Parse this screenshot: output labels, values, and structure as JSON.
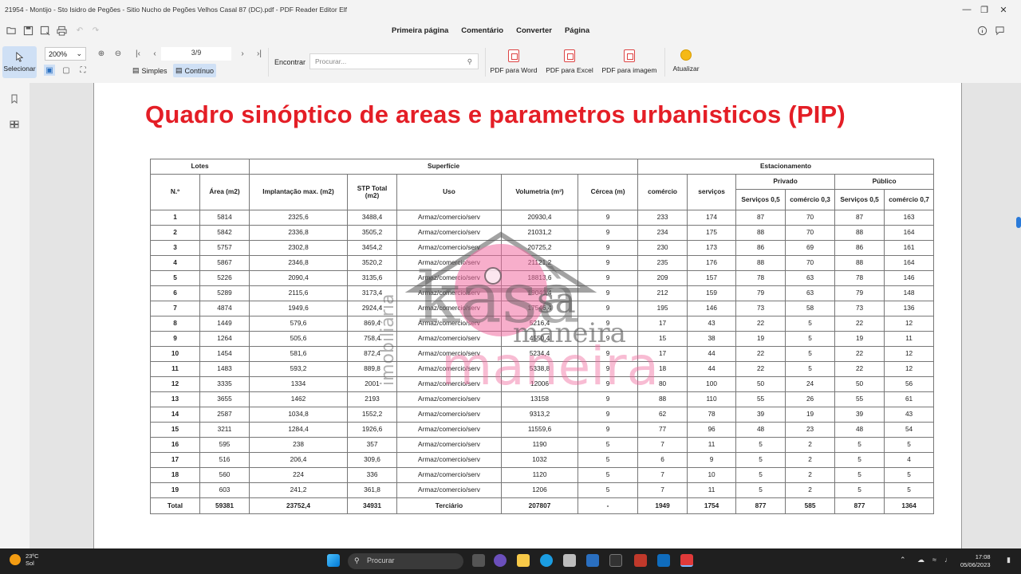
{
  "window": {
    "title": "21954 - Montijo - Sto Isidro de Pegões - Sitio Nucho de Pegões Velhos Casal 87 (DC).pdf - PDF Reader Editor Elf"
  },
  "menu": [
    "Primeira página",
    "Comentário",
    "Converter",
    "Página"
  ],
  "toolbar": {
    "select_label": "Selecionar",
    "zoom_value": "200%",
    "page_value": "3/9",
    "view_single": "Simples",
    "view_continuous": "Contínuo",
    "find_label": "Encontrar",
    "find_placeholder": "Procurar...",
    "pdf_to_word": "PDF para Word",
    "pdf_to_excel": "PDF para Excel",
    "pdf_to_image": "PDF para imagem",
    "update": "Atualizar"
  },
  "document": {
    "title": "Quadro sinóptico de areas e parametros urbanisticos (PIP)",
    "headers": {
      "lotes": "Lotes",
      "superficie": "Superfície",
      "estacionamento": "Estacionamento",
      "n": "N.º",
      "area": "Área (m2)",
      "implantacao": "Implantação max. (m2)",
      "stp_total": "STP Total (m2)",
      "uso": "Uso",
      "volumetria": "Volumetria (m³)",
      "cercea": "Cércea (m)",
      "comercio": "comércio",
      "servicos": "serviços",
      "privado": "Privado",
      "publico": "Público",
      "priv_servicos": "Serviços 0,5",
      "priv_comercio": "comércio 0,3",
      "pub_servicos": "Serviços 0,5",
      "pub_comercio": "comércio 0,7"
    },
    "rows": [
      [
        "1",
        "5814",
        "2325,6",
        "3488,4",
        "Armaz/comercio/serv",
        "20930,4",
        "9",
        "233",
        "174",
        "87",
        "70",
        "87",
        "163"
      ],
      [
        "2",
        "5842",
        "2336,8",
        "3505,2",
        "Armaz/comercio/serv",
        "21031,2",
        "9",
        "234",
        "175",
        "88",
        "70",
        "88",
        "164"
      ],
      [
        "3",
        "5757",
        "2302,8",
        "3454,2",
        "Armaz/comercio/serv",
        "20725,2",
        "9",
        "230",
        "173",
        "86",
        "69",
        "86",
        "161"
      ],
      [
        "4",
        "5867",
        "2346,8",
        "3520,2",
        "Armaz/comercio/serv",
        "21121,2",
        "9",
        "235",
        "176",
        "88",
        "70",
        "88",
        "164"
      ],
      [
        "5",
        "5226",
        "2090,4",
        "3135,6",
        "Armaz/comercio/serv",
        "18813,6",
        "9",
        "209",
        "157",
        "78",
        "63",
        "78",
        "146"
      ],
      [
        "6",
        "5289",
        "2115,6",
        "3173,4",
        "Armaz/comercio/serv",
        "19040,4",
        "9",
        "212",
        "159",
        "79",
        "63",
        "79",
        "148"
      ],
      [
        "7",
        "4874",
        "1949,6",
        "2924,4",
        "Armaz/comercio/serv",
        "17546,4",
        "9",
        "195",
        "146",
        "73",
        "58",
        "73",
        "136"
      ],
      [
        "8",
        "1449",
        "579,6",
        "869,4",
        "Armaz/comercio/serv",
        "5216,4",
        "9",
        "17",
        "43",
        "22",
        "5",
        "22",
        "12"
      ],
      [
        "9",
        "1264",
        "505,6",
        "758,4",
        "Armaz/comercio/serv",
        "4550,4",
        "9",
        "15",
        "38",
        "19",
        "5",
        "19",
        "11"
      ],
      [
        "10",
        "1454",
        "581,6",
        "872,4",
        "Armaz/comercio/serv",
        "5234,4",
        "9",
        "17",
        "44",
        "22",
        "5",
        "22",
        "12"
      ],
      [
        "11",
        "1483",
        "593,2",
        "889,8",
        "Armaz/comercio/serv",
        "5338,8",
        "9",
        "18",
        "44",
        "22",
        "5",
        "22",
        "12"
      ],
      [
        "12",
        "3335",
        "1334",
        "2001",
        "Armaz/comercio/serv",
        "12006",
        "9",
        "80",
        "100",
        "50",
        "24",
        "50",
        "56"
      ],
      [
        "13",
        "3655",
        "1462",
        "2193",
        "Armaz/comercio/serv",
        "13158",
        "9",
        "88",
        "110",
        "55",
        "26",
        "55",
        "61"
      ],
      [
        "14",
        "2587",
        "1034,8",
        "1552,2",
        "Armaz/comercio/serv",
        "9313,2",
        "9",
        "62",
        "78",
        "39",
        "19",
        "39",
        "43"
      ],
      [
        "15",
        "3211",
        "1284,4",
        "1926,6",
        "Armaz/comercio/serv",
        "11559,6",
        "9",
        "77",
        "96",
        "48",
        "23",
        "48",
        "54"
      ],
      [
        "16",
        "595",
        "238",
        "357",
        "Armaz/comercio/serv",
        "1190",
        "5",
        "7",
        "11",
        "5",
        "2",
        "5",
        "5"
      ],
      [
        "17",
        "516",
        "206,4",
        "309,6",
        "Armaz/comercio/serv",
        "1032",
        "5",
        "6",
        "9",
        "5",
        "2",
        "5",
        "4"
      ],
      [
        "18",
        "560",
        "224",
        "336",
        "Armaz/comercio/serv",
        "1120",
        "5",
        "7",
        "10",
        "5",
        "2",
        "5",
        "5"
      ],
      [
        "19",
        "603",
        "241,2",
        "361,8",
        "Armaz/comercio/serv",
        "1206",
        "5",
        "7",
        "11",
        "5",
        "2",
        "5",
        "5"
      ]
    ],
    "total": [
      "Total",
      "59381",
      "23752,4",
      "34931",
      "Terciário",
      "207807",
      "-",
      "1949",
      "1754",
      "877",
      "585",
      "877",
      "1364"
    ],
    "watermark": {
      "line1": "kasà",
      "line2": "sa",
      "line3": "maneira",
      "line4": "maneira",
      "side": "imobiliária"
    }
  },
  "taskbar": {
    "temperature": "23ºC",
    "weather": "Sol",
    "search": "Procurar",
    "time": "17:08",
    "date": "05/06/2023"
  },
  "colors": {
    "title_red": "#e41e26",
    "accent_blue": "#cfe0f5",
    "watermark_pink": "#f06ca0"
  }
}
